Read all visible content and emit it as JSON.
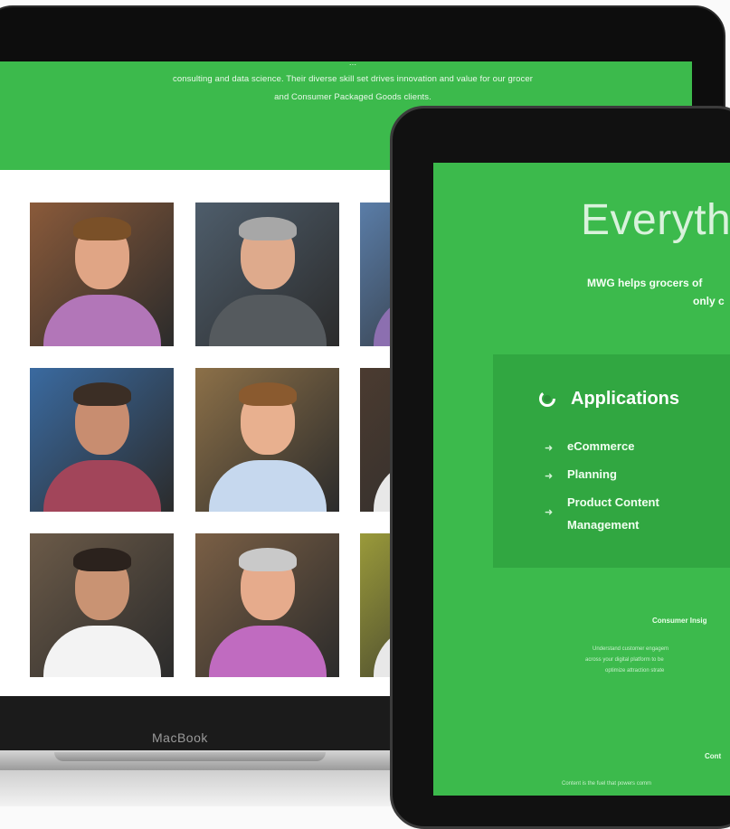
{
  "laptop": {
    "brand": "MacBook",
    "banner_lines": [
      "...",
      "consulting and data science. Their diverse skill set drives innovation and value for our grocer",
      "and Consumer Packaged Goods clients."
    ],
    "team_photos": [
      {
        "bg": "#8a5a3a",
        "skin": "#e0a585",
        "hair": "#7a5028",
        "shirt": "#b276b8"
      },
      {
        "bg": "#4e5d6b",
        "skin": "#deaa8c",
        "hair": "#a7a7a7",
        "shirt": "#555a5e"
      },
      {
        "bg": "#5a7da8",
        "skin": "#e0ab8e",
        "hair": "#4a3a2a",
        "shirt": "#8c6fb0"
      },
      {
        "bg": "#3a6aa0",
        "skin": "#c88d70",
        "hair": "#3b2e25",
        "shirt": "#a2455a"
      },
      {
        "bg": "#8c7048",
        "skin": "#e8b08f",
        "hair": "#8a5a2f",
        "shirt": "#c6d8ee"
      },
      {
        "bg": "#4b3b30",
        "skin": "#c08a6c",
        "hair": "#2a2420",
        "shirt": "#e8e8e8"
      },
      {
        "bg": "#6b5a48",
        "skin": "#c99373",
        "hair": "#2b221d",
        "shirt": "#f3f3f3"
      },
      {
        "bg": "#7a5f45",
        "skin": "#e6ab8c",
        "hair": "#c9c9c9",
        "shirt": "#c06bc0"
      },
      {
        "bg": "#9a9a3a",
        "skin": "#e0a888",
        "hair": "#5a4030",
        "shirt": "#e8e8e8"
      }
    ]
  },
  "tablet": {
    "heading": "Everythi",
    "intro_line1": "MWG helps grocers of",
    "intro_line2": "only c",
    "applications": {
      "title": "Applications",
      "items": [
        "eCommerce",
        "Planning",
        "Product Content",
        "Management"
      ]
    },
    "consumer_insights": {
      "title": "Consumer Insig",
      "lines": [
        "Understand customer engagem",
        "across your digital platform to be",
        "optimize attraction strate"
      ]
    },
    "content": {
      "title": "Cont",
      "line": "Content is the fuel that powers comm"
    }
  },
  "colors": {
    "brand_green": "#3cba4c",
    "card_green": "#31a741"
  }
}
